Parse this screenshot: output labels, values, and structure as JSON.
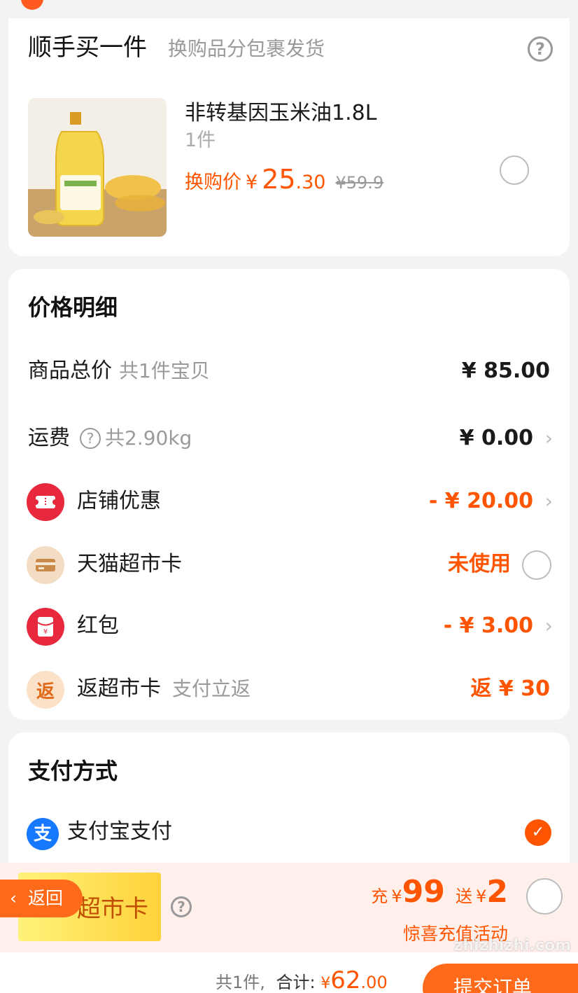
{
  "addon": {
    "title": "顺手买一件",
    "subtitle": "换购品分包裹发货",
    "product": {
      "name": "非转基因玉米油1.8L",
      "qty": "1件",
      "price_label": "换购价",
      "price_yen": "¥",
      "price_int": "25",
      "price_dec": ".30",
      "original_price": "¥59.9",
      "selected": false
    }
  },
  "price_detail": {
    "title": "价格明细",
    "rows": [
      {
        "label": "商品总价",
        "sub": "共1件宝贝",
        "value": "¥ 85.00"
      },
      {
        "label": "运费",
        "sub": "共2.90kg",
        "value": "¥ 0.00"
      },
      {
        "label": "店铺优惠",
        "sub": "",
        "value": "- ¥ 20.00"
      },
      {
        "label": "天猫超市卡",
        "sub": "",
        "value": "未使用"
      },
      {
        "label": "红包",
        "sub": "",
        "value": "- ¥ 3.00"
      },
      {
        "label": "返超市卡",
        "sub": "支付立返",
        "value": "返 ¥ 30"
      }
    ]
  },
  "payment": {
    "title": "支付方式",
    "method": "支付宝支付",
    "alipay_glyph": "支",
    "selected": true
  },
  "promo": {
    "card_text": "超市卡",
    "charge_label": "充",
    "charge_yen": "¥",
    "charge_amount": "99",
    "gift_label": "送",
    "gift_yen": "¥",
    "gift_amount": "2",
    "activity": "惊喜充值活动"
  },
  "back_button": "返回",
  "footer": {
    "count": "共1件,",
    "total_label": "合计:",
    "total_yen": "¥",
    "total_int": "62",
    "total_dec": ".00",
    "submit": "提交订单"
  },
  "watermark": "zhizhizhi.com",
  "colors": {
    "accent": "#ff5500",
    "alipay": "#1677ff",
    "shop_discount_icon": "#e8283c",
    "hongbao_icon": "#e8283c",
    "card_icon": "#f3dcc4"
  },
  "icons": [
    "help-icon",
    "coupon-icon",
    "card-icon",
    "hongbao-icon",
    "rebate-icon",
    "alipay-icon",
    "chevron-right-icon",
    "check-icon",
    "back-arrow-icon"
  ]
}
